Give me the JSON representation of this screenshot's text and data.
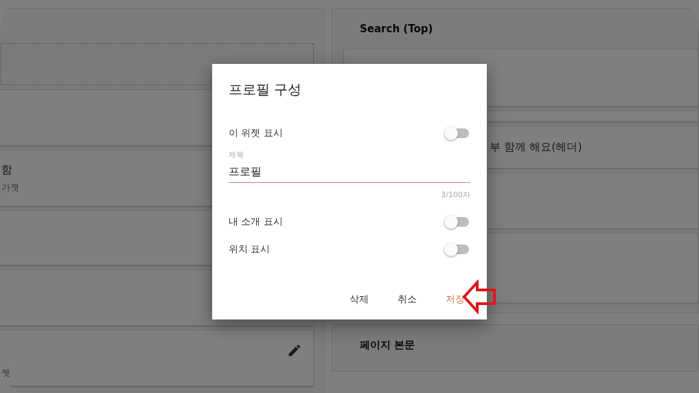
{
  "background": {
    "left_cards": [
      {
        "kind": "dashed"
      },
      {
        "kind": "empty"
      },
      {
        "kind": "text",
        "title": "함",
        "subtitle": "가젯"
      },
      {
        "kind": "empty"
      },
      {
        "kind": "empty"
      },
      {
        "kind": "edit",
        "subtitle": "젯"
      }
    ],
    "right_sections": [
      {
        "title": "Search (Top)",
        "cards": [
          {
            "kind": "blank"
          },
          {
            "kind": "blank"
          },
          {
            "kind": "text",
            "text": "부 함께 해요(헤더)"
          },
          {
            "kind": "blank"
          },
          {
            "kind": "blank"
          }
        ]
      },
      {
        "title": "페이지 본문"
      }
    ]
  },
  "dialog": {
    "title": "프로필 구성",
    "show_widget": {
      "label": "이 위젯 표시",
      "on": false
    },
    "title_field": {
      "label": "제목",
      "value": "프로필",
      "counter": "3/100자"
    },
    "toggles": [
      {
        "label": "내 소개 표시",
        "on": false
      },
      {
        "label": "위치 표시",
        "on": false
      }
    ],
    "buttons": [
      {
        "label": "삭제",
        "kind": "plain"
      },
      {
        "label": "취소",
        "kind": "plain"
      },
      {
        "label": "저장",
        "kind": "primary"
      }
    ]
  }
}
